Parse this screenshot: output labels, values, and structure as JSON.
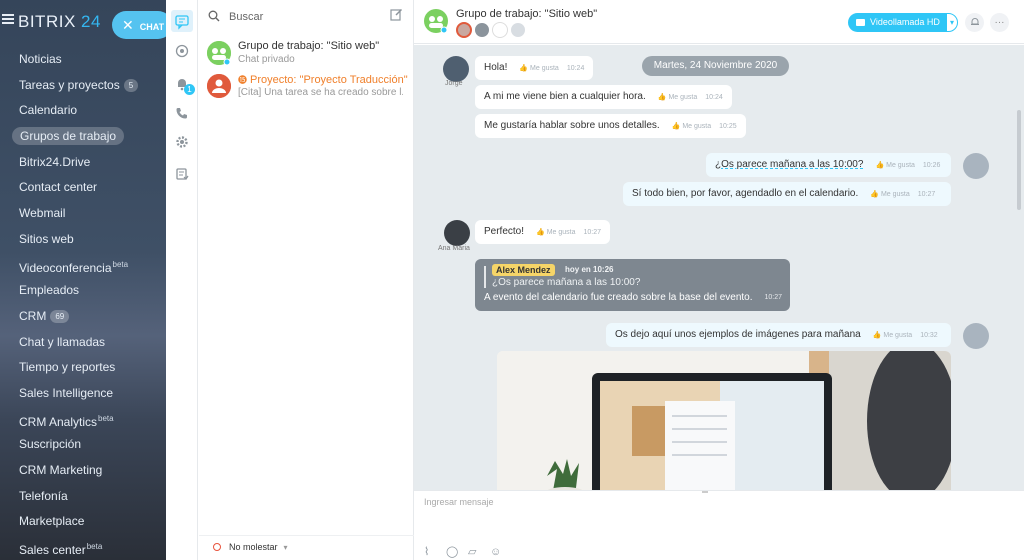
{
  "brand": {
    "name": "BITRIX",
    "number": "24"
  },
  "chat_button": {
    "label": "CHAT"
  },
  "nav": [
    {
      "label": "Noticias"
    },
    {
      "label": "Tareas y proyectos",
      "counter": "5"
    },
    {
      "label": "Calendario"
    },
    {
      "label": "Grupos de trabajo",
      "active": true
    },
    {
      "label": "Bitrix24.Drive"
    },
    {
      "label": "Contact center"
    },
    {
      "label": "Webmail"
    },
    {
      "label": "Sitios web"
    },
    {
      "label": "Videoconferencia",
      "beta": "beta"
    },
    {
      "label": "Empleados"
    },
    {
      "label": "CRM",
      "counter": "69"
    },
    {
      "label": "Chat y llamadas"
    },
    {
      "label": "Tiempo y reportes"
    },
    {
      "label": "Sales Intelligence"
    },
    {
      "label": "CRM Analytics",
      "beta": "beta"
    },
    {
      "label": "Suscripción"
    },
    {
      "label": "CRM Marketing"
    },
    {
      "label": "Telefonía"
    },
    {
      "label": "Marketplace"
    },
    {
      "label": "Sales center",
      "beta": "beta"
    }
  ],
  "rail": {
    "badge": "1"
  },
  "chatlist": {
    "search_placeholder": "Buscar",
    "items": [
      {
        "title": "Grupo de trabajo: \"Sitio web\"",
        "subtitle": "Chat privado"
      },
      {
        "title": "Proyecto: \"Proyecto Traducción\"",
        "subtitle": "[Cita] Una tarea se ha creado sobre l..."
      }
    ],
    "status": "No molestar"
  },
  "header": {
    "title": "Grupo de trabajo: \"Sitio web\"",
    "video_button": "Videollamada HD"
  },
  "messages": {
    "date": "Martes, 24 Noviembre 2020",
    "like": "Me gusta",
    "m1": {
      "text": "Hola!",
      "time": "10:24",
      "author": "Jorge"
    },
    "m2": {
      "text": "A mi me viene bien a cualquier hora.",
      "time": "10:24"
    },
    "m3": {
      "text": "Me gustaría hablar sobre unos detalles.",
      "time": "10:25"
    },
    "m4": {
      "text": "¿Os parece mañana a las 10:00?",
      "time": "10:26"
    },
    "m5": {
      "text": "Sí todo bien, por favor, agendadlo en el calendario.",
      "time": "10:27"
    },
    "m6": {
      "text": "Perfecto!",
      "time": "10:27",
      "author": "Ana Maria"
    },
    "quote": {
      "author": "Alex Mendez",
      "when": "hoy en 10:26",
      "quoted": "¿Os parece mañana a las 10:00?",
      "body": "A evento del calendario fue creado sobre la base del evento.",
      "time": "10:27"
    },
    "m7": {
      "text": "Os dejo aquí unos ejemplos de imágenes para mañana",
      "time": "10:32"
    }
  },
  "input": {
    "placeholder": "Ingresar mensaje"
  },
  "colors": {
    "accent": "#2fc6f6",
    "own_bubble": "#eef9fe",
    "quote_bg": "#7e8790",
    "author_tag": "#f6d568"
  }
}
